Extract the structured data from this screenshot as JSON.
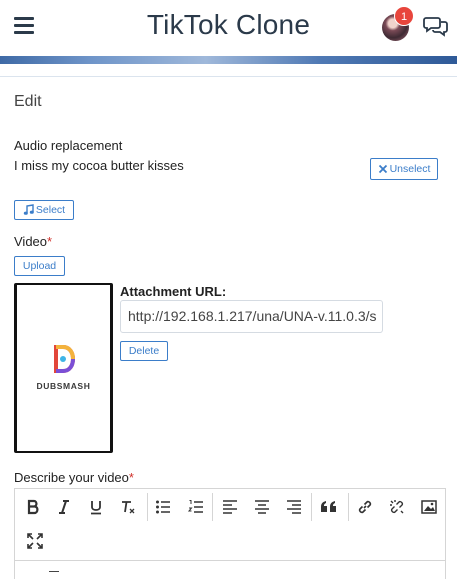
{
  "header": {
    "title": "TikTok Clone",
    "notification_count": "1"
  },
  "page": {
    "heading": "Edit"
  },
  "audio": {
    "label": "Audio replacement",
    "track": "I miss my cocoa butter kisses",
    "unselect_label": "Unselect",
    "select_label": "Select"
  },
  "video": {
    "label": "Video",
    "required_mark": "*",
    "upload_label": "Upload",
    "thumbnail_brand": "DUBSMASH",
    "attachment_label": "Attachment URL:",
    "attachment_url": "http://192.168.1.217/una/UNA-v.11.0.3/s",
    "delete_label": "Delete"
  },
  "description": {
    "label": "Describe your video",
    "required_mark": "*"
  },
  "toolbar": {
    "buttons": [
      "bold",
      "italic",
      "underline",
      "clear-format",
      "bullet-list",
      "numbered-list",
      "align-left",
      "align-center",
      "align-right",
      "quote",
      "link",
      "unlink",
      "image",
      "fullscreen"
    ]
  },
  "colors": {
    "accent": "#3b7dc9",
    "badge": "#e8453c",
    "required": "#d0302a",
    "title": "#2b3a4a"
  }
}
